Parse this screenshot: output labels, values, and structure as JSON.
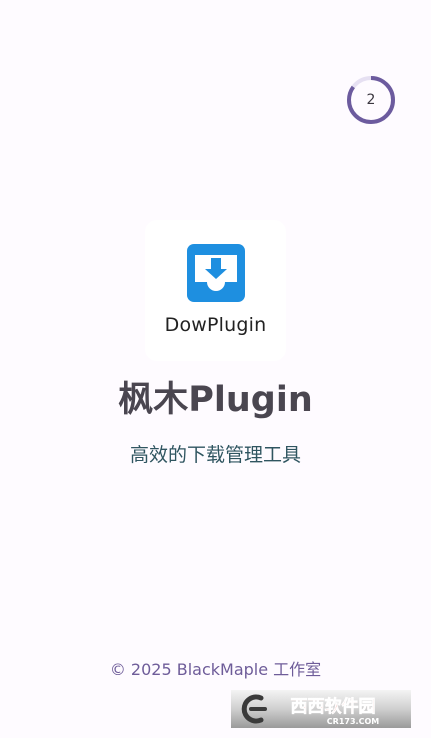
{
  "skip_timer": {
    "count": "2",
    "progress": 0.85,
    "accent_color": "#6c5b9e",
    "track_color": "#e6e0f2"
  },
  "logo": {
    "wordmark": "DowPlugin",
    "icon": "download-tray-icon",
    "icon_color": "#1e8fe0"
  },
  "app": {
    "title": "枫木Plugin",
    "subtitle": "高效的下载管理工具"
  },
  "footer": {
    "copyright": "© 2025 BlackMaple 工作室"
  },
  "watermark": {
    "brand": "西西软件园",
    "domain": "CR173.COM"
  }
}
